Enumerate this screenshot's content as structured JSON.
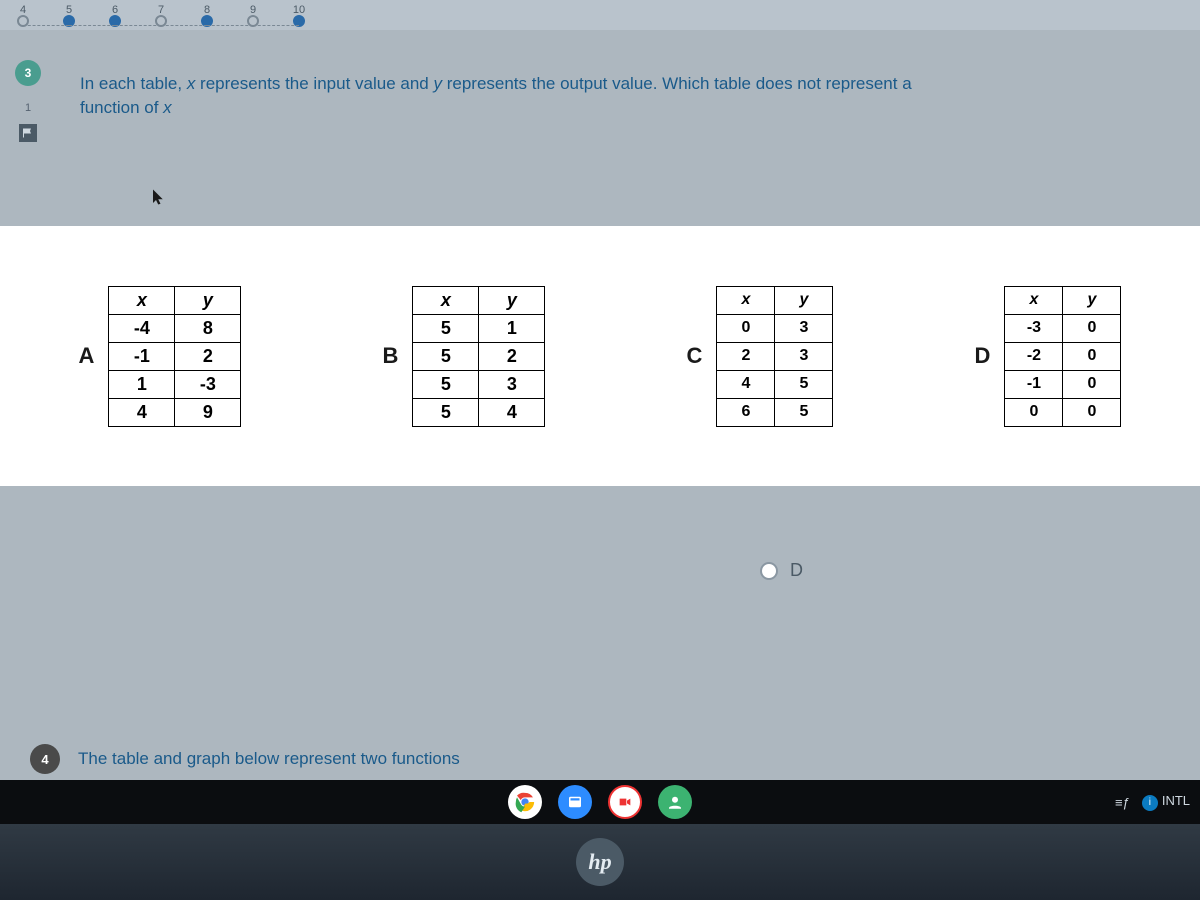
{
  "progress": {
    "steps": [
      {
        "num": "4",
        "filled": false
      },
      {
        "num": "5",
        "filled": true
      },
      {
        "num": "6",
        "filled": true
      },
      {
        "num": "7",
        "filled": false
      },
      {
        "num": "8",
        "filled": true
      },
      {
        "num": "9",
        "filled": false
      },
      {
        "num": "10",
        "filled": true
      }
    ]
  },
  "rail": {
    "current_q": "3",
    "sub_index": "1"
  },
  "question": {
    "line1_a": "In each table, ",
    "line1_b": "x",
    "line1_c": " represents the input value and ",
    "line1_d": "y",
    "line1_e": " represents the output value. Which table does  not represent a",
    "line2_a": "function of ",
    "line2_b": "x"
  },
  "labels": {
    "A": "A",
    "B": "B",
    "C": "C",
    "D": "D"
  },
  "headers": {
    "x": "x",
    "y": "y"
  },
  "tableA": {
    "rows": [
      [
        "-4",
        "8"
      ],
      [
        "-1",
        "2"
      ],
      [
        "1",
        "-3"
      ],
      [
        "4",
        "9"
      ]
    ]
  },
  "tableB": {
    "rows": [
      [
        "5",
        "1"
      ],
      [
        "5",
        "2"
      ],
      [
        "5",
        "3"
      ],
      [
        "5",
        "4"
      ]
    ]
  },
  "tableC": {
    "rows": [
      [
        "0",
        "3"
      ],
      [
        "2",
        "3"
      ],
      [
        "4",
        "5"
      ],
      [
        "6",
        "5"
      ]
    ]
  },
  "tableD": {
    "rows": [
      [
        "-3",
        "0"
      ],
      [
        "-2",
        "0"
      ],
      [
        "-1",
        "0"
      ],
      [
        "0",
        "0"
      ]
    ]
  },
  "answer_d": "D",
  "next_question": {
    "num": "4",
    "text": "The table and graph below represent two functions"
  },
  "taskbar": {
    "intl": "INTL",
    "intl_badge": "i",
    "eq": "≡ƒ"
  },
  "hp": "hp"
}
